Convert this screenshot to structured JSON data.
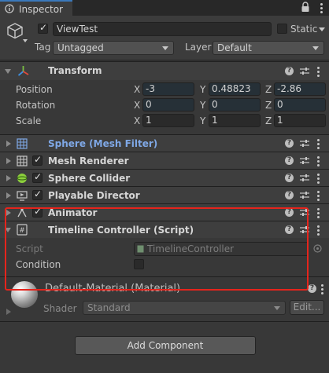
{
  "window": {
    "tab_title": "Inspector"
  },
  "gameobject": {
    "name": "ViewTest",
    "active": true,
    "static_label": "Static",
    "static_checked": false,
    "tag_label": "Tag",
    "tag_value": "Untagged",
    "layer_label": "Layer",
    "layer_value": "Default"
  },
  "transform": {
    "title": "Transform",
    "position_label": "Position",
    "rotation_label": "Rotation",
    "scale_label": "Scale",
    "axis_x": "X",
    "axis_y": "Y",
    "axis_z": "Z",
    "position": {
      "x": "-3",
      "y": "0.48823",
      "z": "-2.86"
    },
    "rotation": {
      "x": "0",
      "y": "0",
      "z": "0"
    },
    "scale": {
      "x": "1",
      "y": "1",
      "z": "1"
    }
  },
  "components": {
    "mesh_filter": "Sphere (Mesh Filter)",
    "mesh_renderer": "Mesh Renderer",
    "sphere_collider": "Sphere Collider",
    "playable_director": "Playable Director",
    "animator": "Animator",
    "timeline_controller": "Timeline Controller (Script)"
  },
  "timeline_controller": {
    "script_label": "Script",
    "script_value": "TimelineController",
    "condition_label": "Condition"
  },
  "material": {
    "title": "Default-Material (Material)",
    "shader_label": "Shader",
    "shader_value": "Standard",
    "edit_label": "Edit..."
  },
  "add_component_label": "Add Component",
  "colors": {
    "background": "#383838",
    "accent_blue": "#3a79bb",
    "highlight_box": "#e5241c",
    "mesh_filter_title": "#7fa8e6"
  }
}
